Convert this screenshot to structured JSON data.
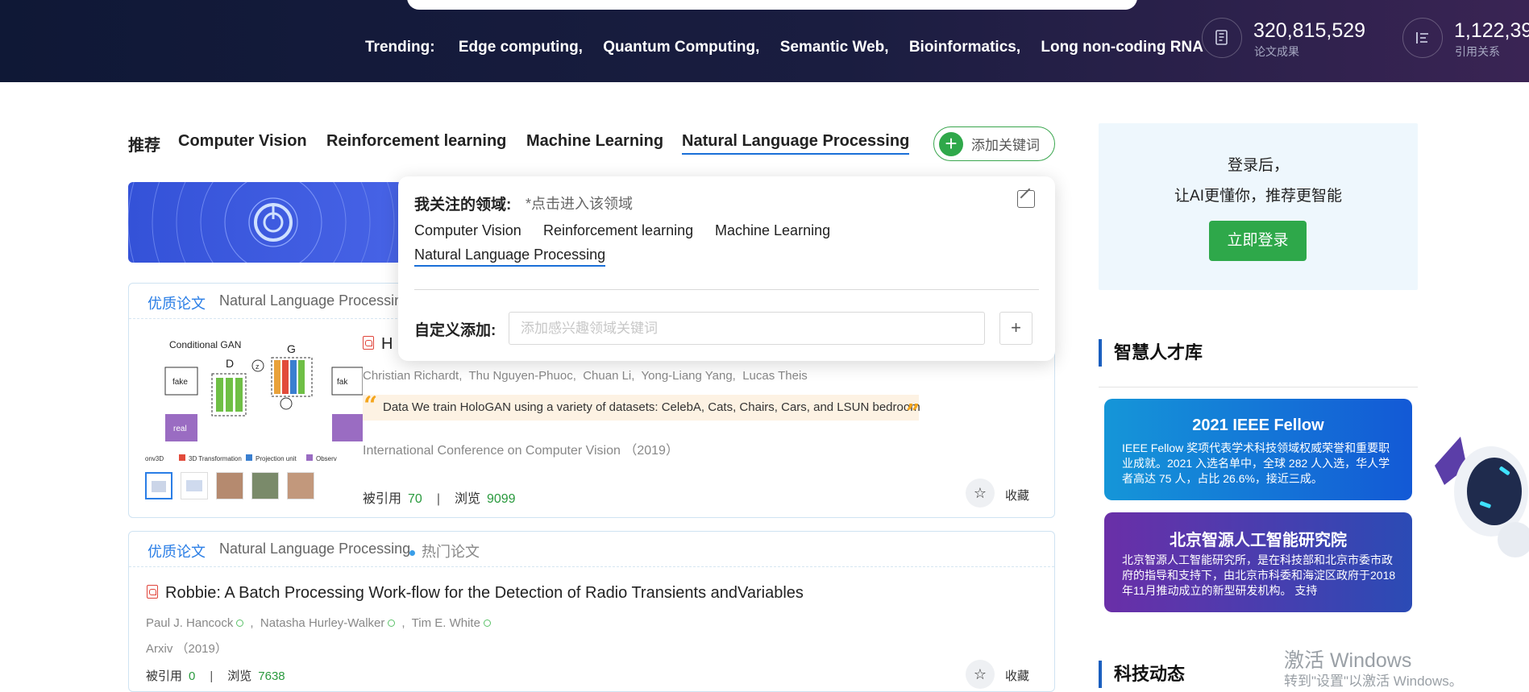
{
  "header": {
    "trending_label": "Trending:",
    "trending_items": [
      "Edge computing,",
      "Quantum Computing,",
      "Semantic Web,",
      "Bioinformatics,",
      "Long non-coding RNA"
    ],
    "stats": [
      {
        "value": "320,815,529",
        "label": "论文成果",
        "icon": "document-icon"
      },
      {
        "value": "1,122,39",
        "label": "引用关系",
        "icon": "list-icon"
      }
    ]
  },
  "tabs": {
    "items": [
      "推荐",
      "Computer Vision",
      "Reinforcement learning",
      "Machine Learning",
      "Natural Language Processing"
    ],
    "active": "Natural Language Processing",
    "add_keyword": "添加关键词"
  },
  "popover": {
    "title": "我关注的领域:",
    "hint": "*点击进入该领域",
    "keywords": [
      "Computer Vision",
      "Reinforcement learning",
      "Machine Learning",
      "Natural Language Processing"
    ],
    "active_keyword": "Natural Language Processing",
    "custom_label": "自定义添加:",
    "input_placeholder": "添加感兴趣领域关键词",
    "input_value": "",
    "add_symbol": "+"
  },
  "cards": [
    {
      "badge": "优质论文",
      "field": "Natural Language Processing",
      "title_visible": "H",
      "figure_label": "Conditional GAN",
      "authors": [
        "Christian Richardt",
        "Thu Nguyen-Phuoc",
        "Chuan Li",
        "Yong-Liang Yang",
        "Lucas Theis"
      ],
      "quote": "Data We train HoloGAN using a variety of datasets: CelebA, Cats, Chairs, Cars, and LSUN bedroom",
      "venue": "International Conference on Computer Vision （2019）",
      "cited_label": "被引用",
      "cited": "70",
      "views_label": "浏览",
      "views": "9099",
      "fav_label": "收藏"
    },
    {
      "badge": "优质论文",
      "field": "Natural Language Processing",
      "hot": "热门论文",
      "title": "Robbie: A Batch Processing Work-flow for the Detection of Radio Transients andVariables",
      "authors": [
        "Paul J. Hancock",
        "Natasha Hurley-Walker",
        "Tim E. White"
      ],
      "venue": "Arxiv （2019）",
      "cited_label": "被引用",
      "cited": "0",
      "views_label": "浏览",
      "views": "7638",
      "fav_label": "收藏"
    }
  ],
  "sidebar": {
    "login_line1": "登录后，",
    "login_line2": "让AI更懂你，推荐更智能",
    "login_button": "立即登录",
    "talent_title": "智慧人才库",
    "promos": [
      {
        "title": "2021 IEEE Fellow",
        "text": "IEEE Fellow 奖项代表学术科技领域权威荣誉和重要职业成就。2021 入选名单中，全球 282 人入选，华人学者高达 75 人，占比 26.6%，接近三成。",
        "color_from": "#1596d8",
        "color_to": "#1359d6"
      },
      {
        "title": "北京智源人工智能研究院",
        "text": "北京智源人工智能研究所，是在科技部和北京市委市政府的指导和支持下，由北京市科委和海淀区政府于2018年11月推动成立的新型研发机构。 支持",
        "color_from": "#6a2fa8",
        "color_to": "#2b4bb5"
      }
    ],
    "news_title": "科技动态"
  },
  "watermark": {
    "line1": "激活 Windows",
    "line2": "转到\"设置\"以激活 Windows。"
  },
  "colors": {
    "header_bg": "#141a3a",
    "accent_green": "#2ea84a",
    "accent_blue": "#1a6fd8",
    "badge_blue": "#2a7ee6"
  }
}
